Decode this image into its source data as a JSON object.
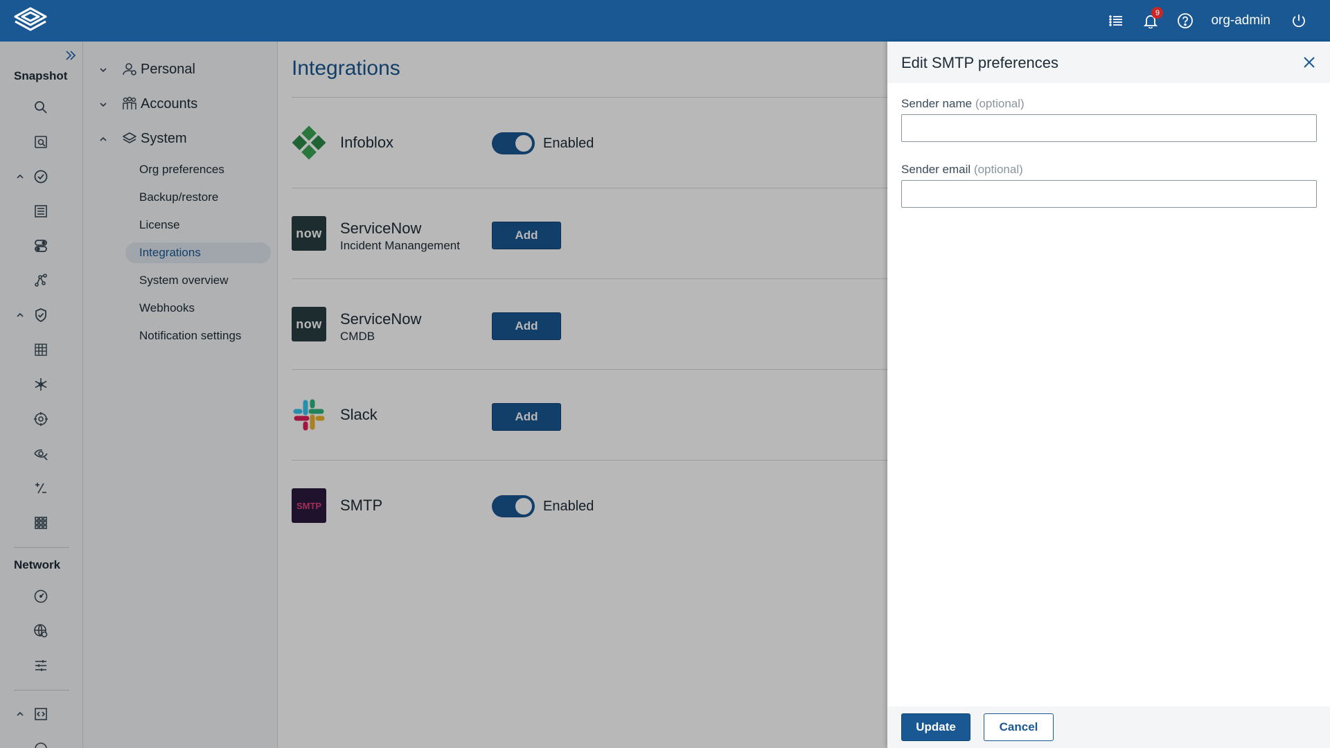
{
  "header": {
    "notification_count": "9",
    "username": "org-admin",
    "icons": [
      "list-icon",
      "bell-icon",
      "help-icon",
      "power-icon"
    ]
  },
  "rail": {
    "section_snapshot": "Snapshot",
    "section_network": "Network"
  },
  "tree": {
    "groups": [
      {
        "label": "Personal",
        "icon": "person-icon",
        "expanded": false
      },
      {
        "label": "Accounts",
        "icon": "accounts-icon",
        "expanded": false
      },
      {
        "label": "System",
        "icon": "layers-icon",
        "expanded": true
      }
    ],
    "items": [
      {
        "label": "Org preferences",
        "active": false
      },
      {
        "label": "Backup/restore",
        "active": false
      },
      {
        "label": "License",
        "active": false
      },
      {
        "label": "Integrations",
        "active": true
      },
      {
        "label": "System overview",
        "active": false
      },
      {
        "label": "Webhooks",
        "active": false
      },
      {
        "label": "Notification settings",
        "active": false
      }
    ]
  },
  "main": {
    "title": "Integrations",
    "integrations": [
      {
        "name": "Infoblox",
        "subtitle": "",
        "state": "toggle",
        "status": "Enabled"
      },
      {
        "name": "ServiceNow",
        "subtitle": "Incident Manangement",
        "state": "add",
        "button": "Add"
      },
      {
        "name": "ServiceNow",
        "subtitle": "CMDB",
        "state": "add",
        "button": "Add"
      },
      {
        "name": "Slack",
        "subtitle": "",
        "state": "add",
        "button": "Add"
      },
      {
        "name": "SMTP",
        "subtitle": "",
        "state": "toggle",
        "status": "Enabled"
      }
    ],
    "logo_text": {
      "servicenow": "now",
      "smtp": "SMTP"
    }
  },
  "drawer": {
    "title": "Edit SMTP preferences",
    "fields": [
      {
        "label": "Sender name",
        "hint": "(optional)",
        "value": ""
      },
      {
        "label": "Sender email",
        "hint": "(optional)",
        "value": ""
      }
    ],
    "update_label": "Update",
    "cancel_label": "Cancel"
  },
  "colors": {
    "brand": "#1a5894",
    "badge": "#c62828"
  }
}
